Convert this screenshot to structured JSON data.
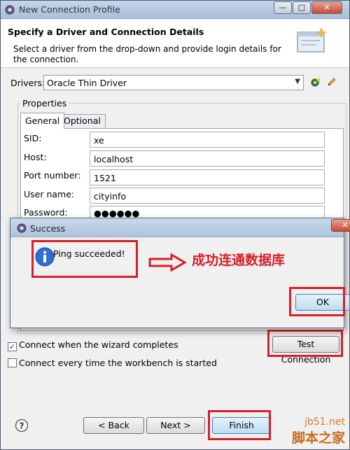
{
  "window": {
    "title": "New Connection Profile",
    "min_glyph": "—",
    "max_glyph": "□",
    "close_glyph": "✕"
  },
  "header": {
    "title": "Specify a Driver and Connection Details",
    "description": "Select a driver from the drop-down and provide login details for the connection."
  },
  "drivers": {
    "label": "Drivers:",
    "selected": "Oracle Thin Driver"
  },
  "properties": {
    "group_label": "Properties",
    "tabs": [
      "General",
      "Optional"
    ],
    "fields": [
      {
        "label": "SID:",
        "value": "xe"
      },
      {
        "label": "Host:",
        "value": "localhost"
      },
      {
        "label": "Port number:",
        "value": "1521"
      },
      {
        "label": "User name:",
        "value": "cityinfo"
      },
      {
        "label": "Password:",
        "value": "●●●●●●"
      }
    ]
  },
  "options": {
    "connect_when_complete": {
      "label": "Connect when the wizard completes",
      "checked": true,
      "glyph": "✓"
    },
    "connect_every_time": {
      "label": "Connect every time the workbench is started",
      "checked": false
    }
  },
  "buttons": {
    "test_connection": "Test Connection",
    "back": "< Back",
    "next": "Next >",
    "finish": "Finish"
  },
  "success_dialog": {
    "title": "Success",
    "message": "Ping succeeded!",
    "ok": "OK",
    "close_glyph": "✕"
  },
  "annotation": {
    "text": "成功连通数据库"
  },
  "watermark": {
    "line1": "jb51.net",
    "line2": "脚本之家"
  },
  "colors": {
    "annotation_red": "#d6202a",
    "title_bar": "#b4c8e0"
  }
}
